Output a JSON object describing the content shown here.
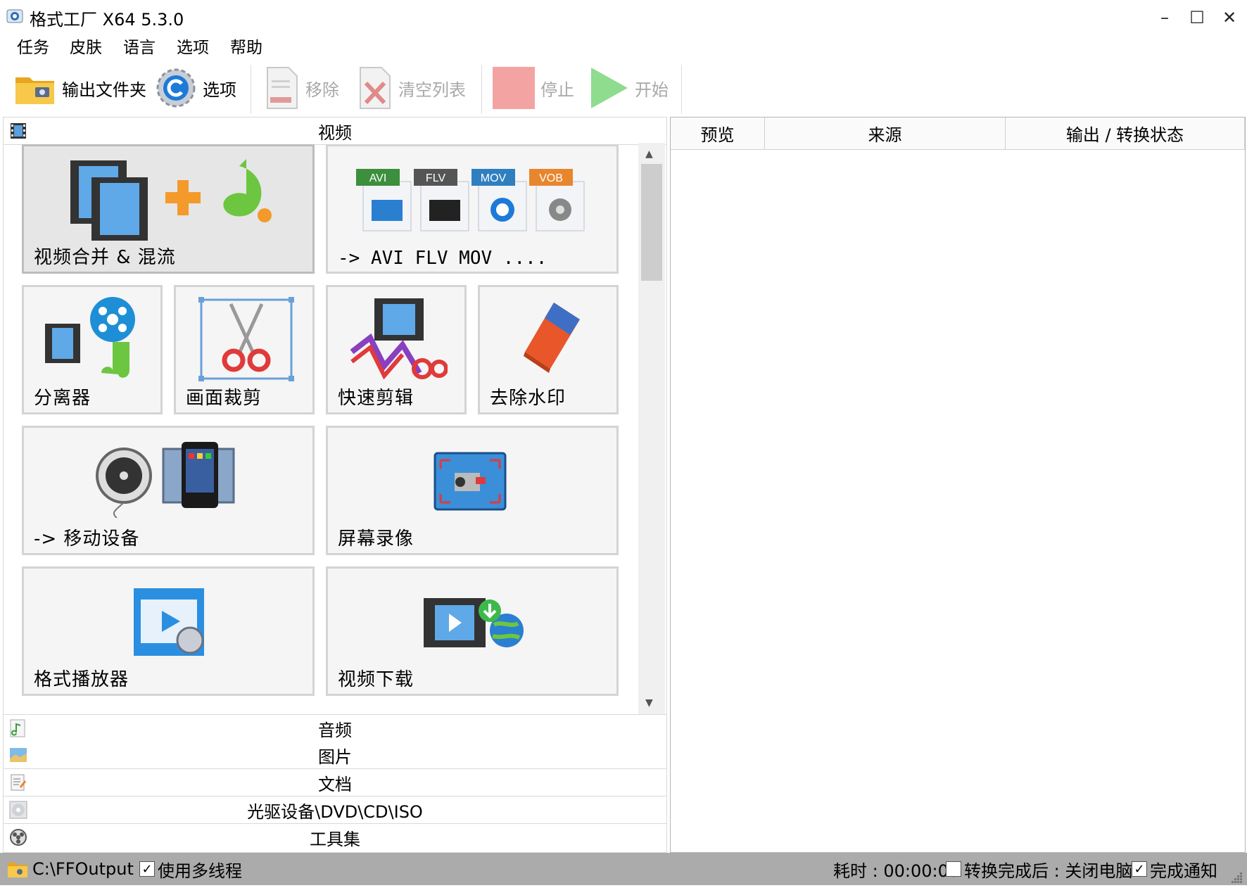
{
  "window": {
    "title": "格式工厂 X64 5.3.0",
    "minimize": "–",
    "maximize": "☐",
    "close": "✕"
  },
  "menu": [
    "任务",
    "皮肤",
    "语言",
    "选项",
    "帮助"
  ],
  "toolbar": {
    "output_folder": "输出文件夹",
    "options": "选项",
    "remove": "移除",
    "clear_list": "清空列表",
    "stop": "停止",
    "start": "开始"
  },
  "categories": {
    "video": "视频",
    "audio": "音频",
    "image": "图片",
    "document": "文档",
    "optical": "光驱设备\\DVD\\CD\\ISO",
    "tools": "工具集"
  },
  "tiles": {
    "merge": "视频合并 & 混流",
    "convert": "-> AVI FLV MOV ....",
    "splitter": "分离器",
    "crop": "画面裁剪",
    "quick_cut": "快速剪辑",
    "remove_watermark": "去除水印",
    "mobile": "-> 移动设备",
    "screen_record": "屏幕录像",
    "player": "格式播放器",
    "download": "视频下载"
  },
  "format_badges": [
    "AVI",
    "FLV",
    "MOV",
    "VOB"
  ],
  "task_list": {
    "columns": [
      "预览",
      "来源",
      "输出 / 转换状态"
    ]
  },
  "status": {
    "output_path": "C:\\FFOutput",
    "multithread": "使用多线程",
    "multithread_checked": true,
    "elapsed": "耗时 : 00:00:00",
    "after_done": "转换完成后 : 关闭电脑",
    "after_done_checked": false,
    "notify": "完成通知",
    "notify_checked": true
  },
  "colors": {
    "accent_blue": "#1d7ad8",
    "stop_red": "#f4a3a3",
    "start_green": "#8fdc8f",
    "statusbar": "#ababab"
  }
}
